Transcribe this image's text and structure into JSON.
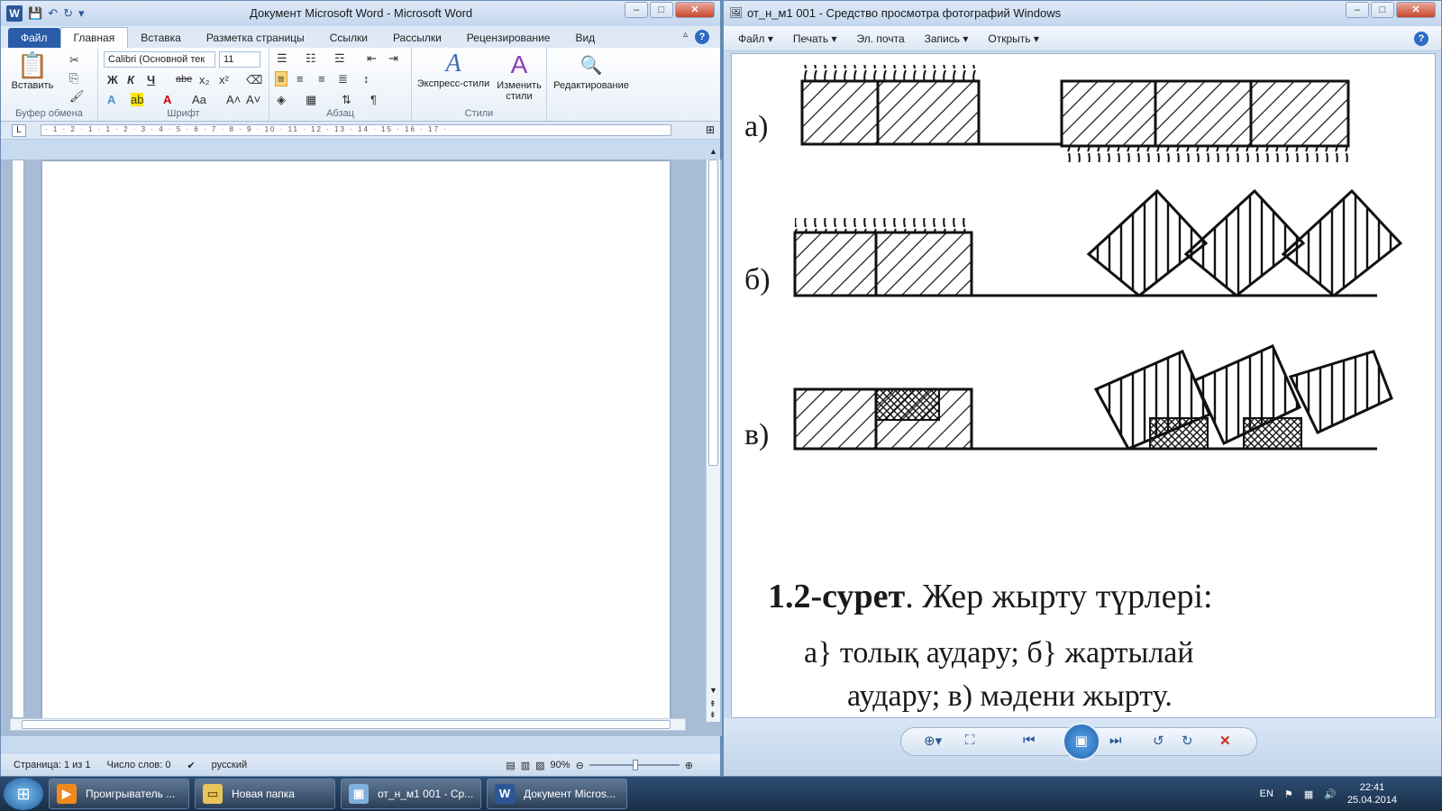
{
  "word": {
    "title": "Документ Microsoft Word  -  Microsoft Word",
    "tabs": [
      "Файл",
      "Главная",
      "Вставка",
      "Разметка страницы",
      "Ссылки",
      "Рассылки",
      "Рецензирование",
      "Вид"
    ],
    "paste_label": "Вставить",
    "font_name": "Calibri (Основной тек",
    "font_size": "11",
    "bold": "Ж",
    "italic": "К",
    "underline": "Ч",
    "strike": "abe",
    "font_color_glyph": "A",
    "case_glyph": "Aa",
    "pilcrow": "¶",
    "express_styles": "Экспресс-стили",
    "change_styles_1": "Изменить",
    "change_styles_2": "стили",
    "editing": "Редактирование",
    "groups": [
      "Буфер обмена",
      "Шрифт",
      "Абзац",
      "Стили"
    ],
    "ruler_text": "· 1 · 2 · 1 · 1 · 2 · 3 · 4 · 5 · 6 · 7 · 8 · 9 · 10 · 11 · 12 · 13 · 14 · 15 · 16 · 17 ·",
    "status": {
      "page": "Страница: 1 из 1",
      "words": "Число слов: 0",
      "language": "русский",
      "zoom": "90%"
    }
  },
  "viewer": {
    "title": "от_н_м1 001 - Средство просмотра фотографий Windows",
    "menu": [
      "Файл ▾",
      "Печать ▾",
      "Эл. почта",
      "Запись ▾",
      "Открыть ▾"
    ],
    "photo": {
      "label_a": "а)",
      "label_b": "б)",
      "label_v": "в)",
      "caption_bold": "1.2-сурет",
      "caption_rest": ". Жер жырту түрлері:",
      "line2": "а} толық аудару;  б} жартылай",
      "line3": "аудару; в) мәдени жырту."
    }
  },
  "taskbar": {
    "items": [
      "Проигрыватель ...",
      "Новая папка",
      "от_н_м1 001 - Ср...",
      "Документ Micros..."
    ],
    "lang": "EN",
    "time": "22:41",
    "date": "25.04.2014"
  }
}
